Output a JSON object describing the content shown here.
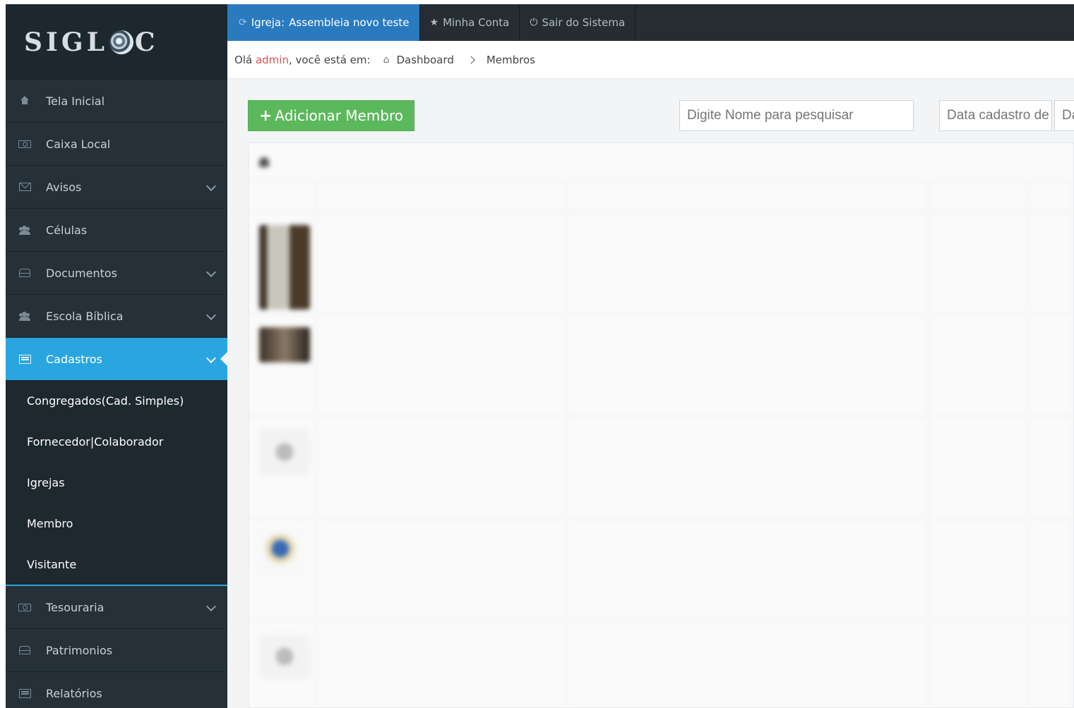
{
  "app": {
    "logo_text_left": "SIGL",
    "logo_text_right": "C"
  },
  "topbar": {
    "church_prefix": "Igreja:",
    "church_name": "Assembleia novo teste",
    "account": "Minha Conta",
    "logout": "Sair do Sistema"
  },
  "breadcrumb": {
    "greeting_prefix": "Olá",
    "user": "admin",
    "greeting_suffix": ", você está em:",
    "home": "Dashboard",
    "current": "Membros"
  },
  "sidebar": {
    "items": [
      {
        "label": "Tela Inicial",
        "icon": "home-icon"
      },
      {
        "label": "Caixa Local",
        "icon": "money-icon"
      },
      {
        "label": "Avisos",
        "icon": "envelope-icon"
      },
      {
        "label": "Células",
        "icon": "users-icon"
      },
      {
        "label": "Documentos",
        "icon": "drive-icon"
      },
      {
        "label": "Escola Bíblica",
        "icon": "users-icon"
      },
      {
        "label": "Cadastros",
        "icon": "list-icon"
      },
      {
        "label": "Tesouraria",
        "icon": "money-icon"
      },
      {
        "label": "Patrimonios",
        "icon": "drive-icon"
      },
      {
        "label": "Relatórios",
        "icon": "list-icon"
      }
    ],
    "submenu": [
      "Congregados(Cad. Simples)",
      "Fornecedor|Colaborador",
      "Igrejas",
      "Membro",
      "Visitante"
    ]
  },
  "main": {
    "add_button": "Adicionar Membro",
    "search_name_placeholder": "Digite Nome para pesquisar",
    "search_date_placeholder": "Data cadastro de",
    "search_date2_placeholder": "Da"
  },
  "colors": {
    "sidebar_bg": "#253038",
    "active_blue": "#29a6e0",
    "top_tab_active": "#2a7ac0",
    "add_green": "#5cb85c",
    "user_red": "#d9534f"
  }
}
